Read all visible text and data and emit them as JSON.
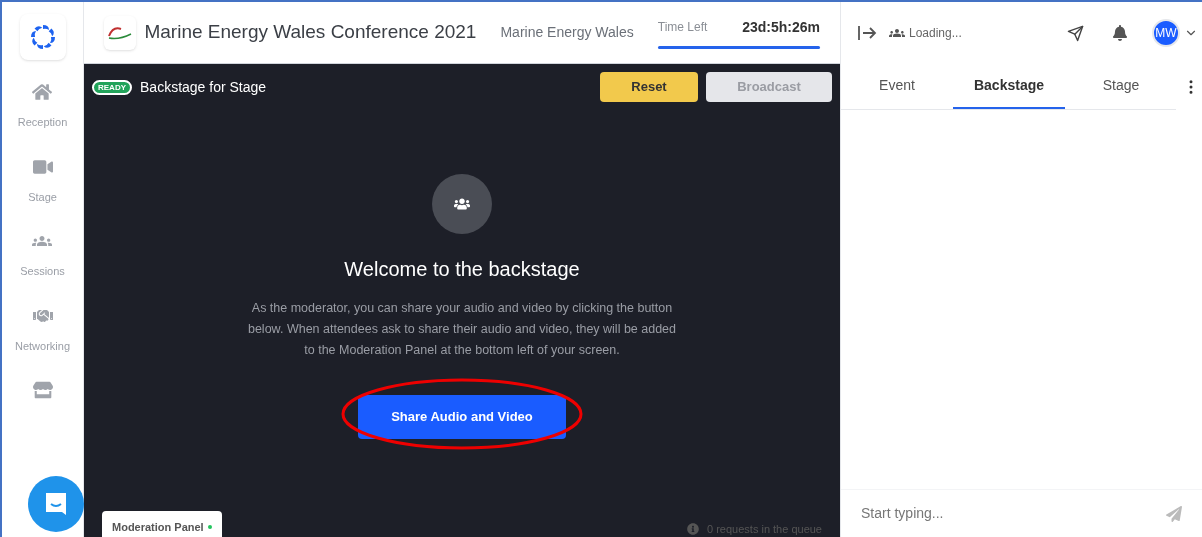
{
  "sidebar": {
    "items": [
      {
        "kind": "labeled",
        "label": "Reception"
      },
      {
        "kind": "labeled",
        "label": "Stage"
      },
      {
        "kind": "labeled",
        "label": "Sessions"
      },
      {
        "kind": "labeled",
        "label": "Networking"
      },
      {
        "kind": "icon_only"
      }
    ]
  },
  "header": {
    "title": "Marine Energy Wales Conference 2021",
    "organizer": "Marine Energy Wales",
    "time_label": "Time Left",
    "time_value": "23d:5h:26m",
    "timer": {
      "level": 1
    }
  },
  "backstage": {
    "status": "READY",
    "title": "Backstage for Stage",
    "buttons": [
      {
        "label": "Reset",
        "disabled": false
      },
      {
        "label": "Broadcast",
        "disabled": true
      }
    ],
    "heading": "Welcome to the backstage",
    "body": "As the moderator, you can share your audio and video by clicking the button below. When attendees ask to share their audio and video, they will be added to the Moderation Panel at the bottom left of your screen.",
    "cta": "Share Audio and Video",
    "cta_highlighted": true,
    "panel_tab": "Moderation Panel",
    "panel_online": true,
    "queue": "0 requests in the queue"
  },
  "right_panel": {
    "status": "Loading...",
    "avatar": "MW",
    "tabs": [
      {
        "label": "Event",
        "selected": false
      },
      {
        "label": "Backstage",
        "selected": true
      },
      {
        "label": "Stage",
        "selected": false
      }
    ],
    "chat_placeholder": "Start typing..."
  }
}
